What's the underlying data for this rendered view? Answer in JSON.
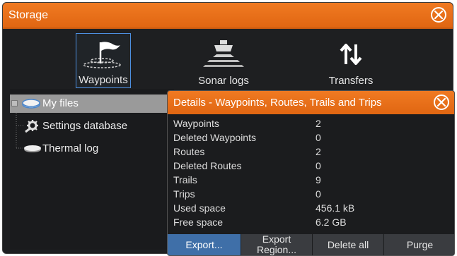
{
  "window": {
    "title": "Storage",
    "close_glyph": "close-icon"
  },
  "toolbar": {
    "items": [
      {
        "label": "Waypoints",
        "icon": "waypoint-flag-icon",
        "selected": true
      },
      {
        "label": "Sonar logs",
        "icon": "sonar-boat-icon",
        "selected": false
      },
      {
        "label": "Transfers",
        "icon": "transfer-arrows-icon",
        "selected": false
      }
    ]
  },
  "tree": {
    "items": [
      {
        "label": "My files",
        "icon": "disk-icon",
        "selected": true
      },
      {
        "label": "Settings database",
        "icon": "settings-gear-icon",
        "selected": false
      },
      {
        "label": "Thermal log",
        "icon": "disk-icon",
        "selected": false
      }
    ]
  },
  "details": {
    "title": "Details - Waypoints, Routes, Trails and Trips",
    "rows": [
      {
        "key": "Waypoints",
        "value": "2"
      },
      {
        "key": "Deleted Waypoints",
        "value": "0"
      },
      {
        "key": "Routes",
        "value": "2"
      },
      {
        "key": "Deleted Routes",
        "value": "0"
      },
      {
        "key": "Trails",
        "value": "9"
      },
      {
        "key": "Trips",
        "value": "0"
      },
      {
        "key": "Used space",
        "value": "456.1 kB"
      },
      {
        "key": "Free space",
        "value": "6.2 GB"
      }
    ],
    "buttons": {
      "export": "Export...",
      "export_region_line1": "Export",
      "export_region_line2": "Region...",
      "delete_all": "Delete all",
      "purge": "Purge"
    }
  },
  "colors": {
    "accent_orange": "#e8701a",
    "selection_blue": "#4d8fe0",
    "primary_button": "#3f6fa8"
  }
}
